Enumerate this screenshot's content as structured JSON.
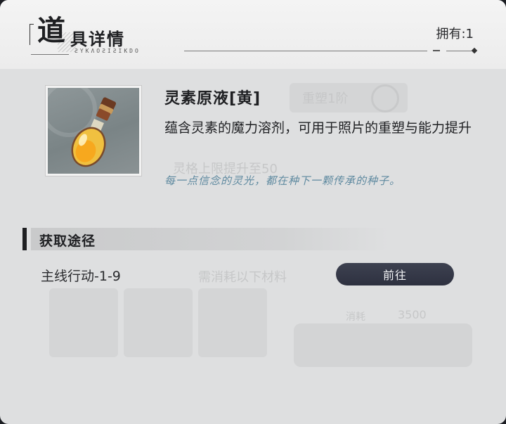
{
  "header": {
    "title_big": "道",
    "title_rest": "具详情",
    "subtitle_code": "ƧΥKɅOƧIƧIKDO",
    "owned_label": "拥有:1"
  },
  "background": {
    "tab_label": "重塑1阶",
    "line1": "灵格上限提升至50",
    "line2": "需消耗以下材料",
    "cost_label": "消耗",
    "cost_value": "3500"
  },
  "item": {
    "name": "灵素原液[黄]",
    "description": "蕴含灵素的魔力溶剂，可用于照片的重塑与能力提升",
    "flavor": "每一点信念的灵光，都在种下一颗传承的种子。",
    "icon": "potion-bottle-yellow"
  },
  "acquire": {
    "section_title": "获取途径",
    "routes": [
      {
        "label": "主线行动-1-9",
        "button": "前往"
      }
    ]
  },
  "colors": {
    "accent_text": "#5f8aa0",
    "button_bg": "#343848",
    "panel_bg": "#dedfe0"
  }
}
